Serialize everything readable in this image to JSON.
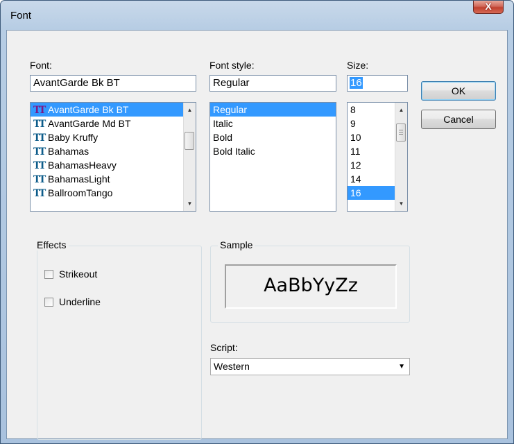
{
  "window": {
    "title": "Font",
    "close_label": "X"
  },
  "font": {
    "label": "Font:",
    "value": "AvantGarde Bk BT",
    "items": [
      "AvantGarde Bk BT",
      "AvantGarde Md BT",
      "Baby Kruffy",
      "Bahamas",
      "BahamasHeavy",
      "BahamasLight",
      "BallroomTango"
    ],
    "selected": "AvantGarde Bk BT",
    "icon": "truetype-font-icon",
    "icon_glyph": "TT"
  },
  "font_style": {
    "label": "Font style:",
    "value": "Regular",
    "items": [
      "Regular",
      "Italic",
      "Bold",
      "Bold Italic"
    ],
    "selected": "Regular"
  },
  "size": {
    "label": "Size:",
    "value": "16",
    "items": [
      "8",
      "9",
      "10",
      "11",
      "12",
      "14",
      "16"
    ],
    "selected": "16"
  },
  "buttons": {
    "ok": "OK",
    "cancel": "Cancel"
  },
  "effects": {
    "label": "Effects",
    "strikeout": {
      "label": "Strikeout",
      "checked": false
    },
    "underline": {
      "label": "Underline",
      "checked": false
    }
  },
  "sample": {
    "label": "Sample",
    "text": "AaBbYyZz"
  },
  "script": {
    "label": "Script:",
    "value": "Western"
  },
  "colors": {
    "selection": "#3399ff",
    "dialog_bg": "#f0f0f0",
    "close_red": "#c0402e"
  }
}
